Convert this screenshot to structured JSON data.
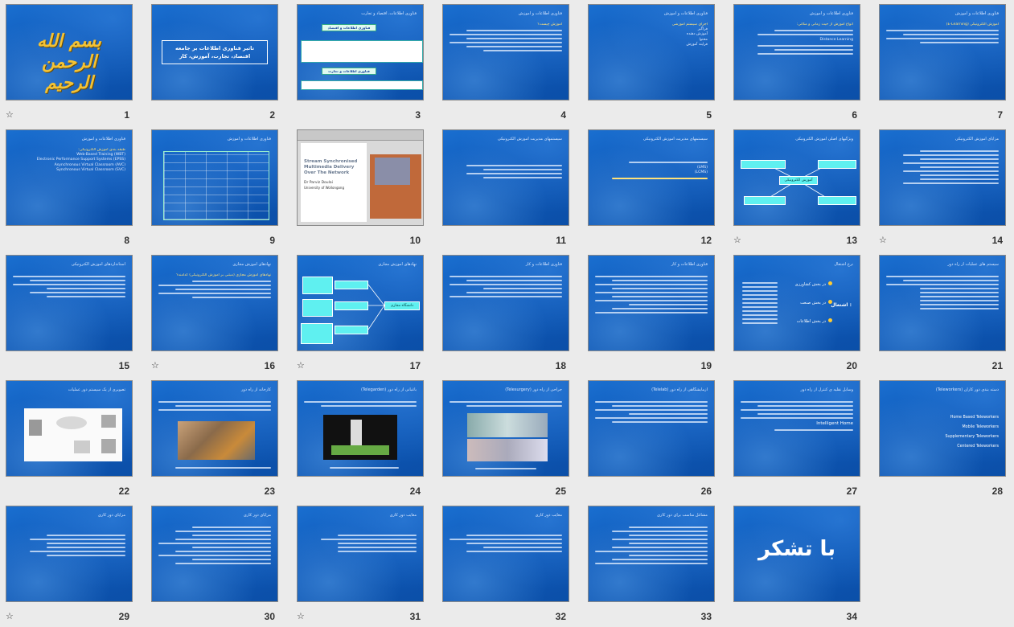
{
  "slides": [
    {
      "n": "1",
      "title": "بسم الله الرحمن الرحیم",
      "star": true
    },
    {
      "n": "2",
      "title": "تاثیر فناوری اطلاعات بر جامعه",
      "subtitle": "اقتصاد، تجارت، آموزش، کار",
      "star": false
    },
    {
      "n": "3",
      "header": "فناوری اطلاعات، اقتصاد و تجارت",
      "box1": "فناوری اطلاعات و اقتصاد",
      "box2": "فناوری اطلاعات و تجارت",
      "star": false
    },
    {
      "n": "4",
      "header": "فناوری اطلاعات و آموزش",
      "heading": "آموزش چیست؟",
      "star": false
    },
    {
      "n": "5",
      "header": "فناوری اطلاعات و آموزش",
      "heading": "اجزای سیستم آموزشی",
      "items": [
        "فراگیر",
        "آموزش دهنده",
        "محتوا",
        "فرایند آموزش"
      ],
      "star": false
    },
    {
      "n": "6",
      "header": "فناوری اطلاعات و آموزش",
      "heading": "انواع آموزش از حیث زمانی و مکانی:",
      "extra": "Distance Learning",
      "star": false
    },
    {
      "n": "7",
      "header": "فناوری اطلاعات و آموزش",
      "heading": "آموزش الکترونیکی (E-Learning)",
      "star": false
    },
    {
      "n": "8",
      "header": "فناوری اطلاعات و آموزش",
      "heading": "طبقه بندی آموزش الکترونیکی:",
      "items": [
        "Web-Based Training (WBT)",
        "Electronic Performance Support Systems (EPSS)",
        "Asynchronous Virtual Classroom (AVC)",
        "Synchronous Virtual Classroom (SVC)"
      ],
      "star": false
    },
    {
      "n": "9",
      "header": "فناوری اطلاعات و آموزش",
      "star": false
    },
    {
      "n": "10",
      "title": "Stream Synchronised Multimedia Delivery Over The Network",
      "author": "Dr Parviz Doulai",
      "org": "University of Wollongong",
      "star": false
    },
    {
      "n": "11",
      "header": "سیستمهای مدیریت آموزش الکترونیکی",
      "star": false
    },
    {
      "n": "12",
      "header": "سیستمهای مدیریت آموزش الکترونیکی",
      "items": [
        "(LMS)",
        "(LCMS)"
      ],
      "star": false
    },
    {
      "n": "13",
      "header": "ویژگیهای اصلی آموزش الکترونیکی",
      "center": "آموزش الکترونیکی",
      "star": true
    },
    {
      "n": "14",
      "header": "مزایای آموزش الکترونیکی",
      "star": true
    },
    {
      "n": "15",
      "header": "استانداردهای آموزش الکترونیکی",
      "star": false
    },
    {
      "n": "16",
      "header": "نهادهای آموزش مجازی",
      "heading": "نهادهای آموزش مجازی (مبتنی بر آموزش الکترونیکی) کدامند؟",
      "star": true
    },
    {
      "n": "17",
      "header": "نهادهای آموزش مجازی",
      "center": "دانشگاه مجازی",
      "star": true
    },
    {
      "n": "18",
      "header": "فناوری اطلاعات و کار",
      "star": false
    },
    {
      "n": "19",
      "header": "فناوری اطلاعات و کار",
      "star": false
    },
    {
      "n": "20",
      "header": "نرخ اشتغال",
      "items": [
        "در بخش کشاورزی",
        "در بخش صنعت",
        "در بخش اطلاعات"
      ],
      "label": "اشتغال :",
      "star": false
    },
    {
      "n": "21",
      "header": "سیستم های عملیات از راه دور",
      "star": false
    },
    {
      "n": "22",
      "header": "تصویری از یک سیستم دور عملیات",
      "star": false
    },
    {
      "n": "23",
      "header": "کارخانه از راه دور",
      "star": false
    },
    {
      "n": "24",
      "header": "باغبانی از راه دور (Telegarden)",
      "star": false
    },
    {
      "n": "25",
      "header": "جراحی از راه دور (Telesurgery)",
      "star": false
    },
    {
      "n": "26",
      "header": "آزمایشگاهی از راه دور (Telelab)",
      "star": false
    },
    {
      "n": "27",
      "header": "وسایل نقلیه ی کنترل از راه دور",
      "heading": "Intelligent Home",
      "star": false
    },
    {
      "n": "28",
      "header": "دسته بندی دور کاران (Teleworkers)",
      "items": [
        "Home Based Teleworkers",
        "Mobile Teleworkers",
        "Supplementary Teleworkers",
        "Centered Teleworkers"
      ],
      "star": false
    },
    {
      "n": "29",
      "header": "مزایای دور کاری",
      "star": true
    },
    {
      "n": "30",
      "header": "مزایای دور کاری",
      "star": false
    },
    {
      "n": "31",
      "header": "معایب دور کاری",
      "star": true
    },
    {
      "n": "32",
      "header": "معایب دور کاری",
      "star": false
    },
    {
      "n": "33",
      "header": "مشاغل مناسب برای دور کاری",
      "star": false
    },
    {
      "n": "34",
      "title": "با تشکر",
      "star": false
    }
  ]
}
